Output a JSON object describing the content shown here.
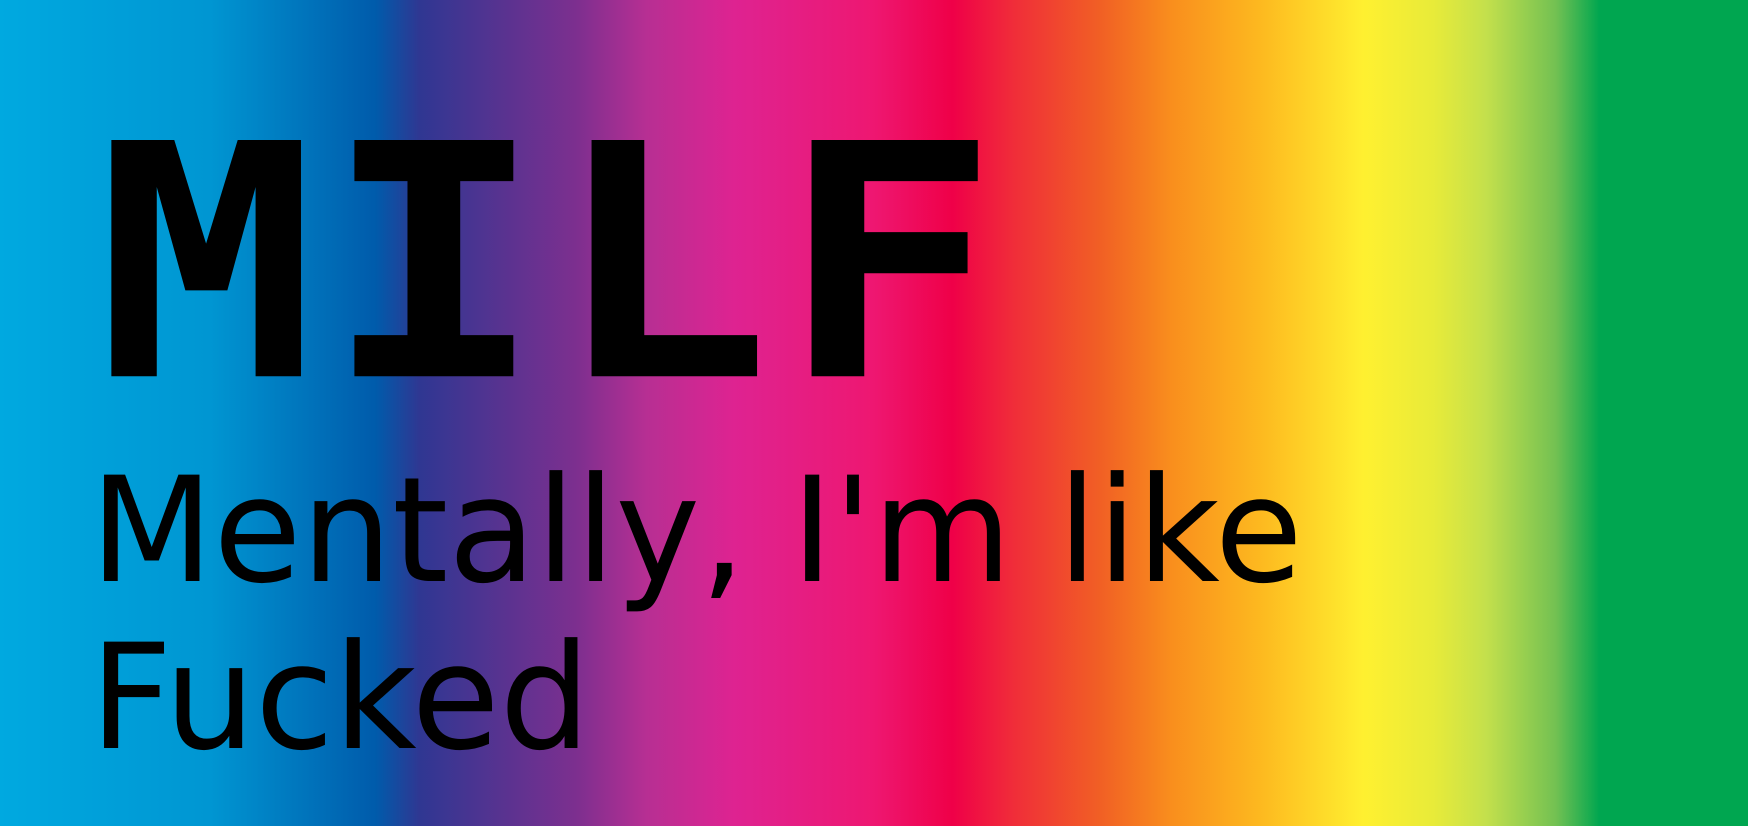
{
  "poster": {
    "title": "MILF",
    "subtitle_line_1": "Mentally, I'm like",
    "subtitle_line_2": "Fucked"
  },
  "colors": {
    "text": "#000000",
    "gradient_start": "#00a9e0",
    "gradient_blue": "#005bab",
    "gradient_purple": "#7d2f8f",
    "gradient_pink": "#de2391",
    "gradient_red": "#ef0048",
    "gradient_orange": "#f98e1d",
    "gradient_yellow": "#fff030",
    "gradient_end": "#00a650"
  }
}
